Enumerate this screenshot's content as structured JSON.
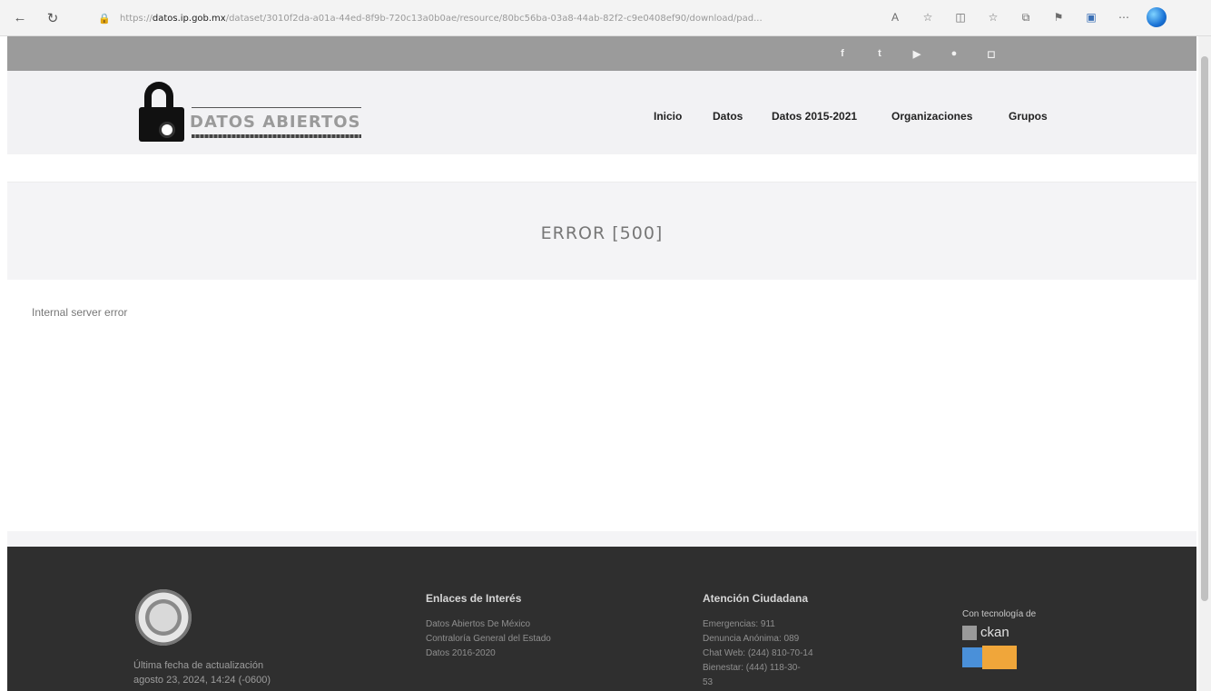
{
  "browser": {
    "url_prefix": "https://",
    "url_host": "datos.ip.gob.mx",
    "url_rest": "/dataset/3010f2da-a01a-44ed-8f9b-720c13a0b0ae/resource/80bc56ba-03a8-44ab-82f2-c9e0408ef90/download/pad...",
    "back_icon": "back-arrow-icon",
    "reload_icon": "reload-icon"
  },
  "social": {
    "items": [
      {
        "name": "facebook",
        "glyph": "f"
      },
      {
        "name": "twitter",
        "glyph": "t"
      },
      {
        "name": "youtube",
        "glyph": "▶"
      },
      {
        "name": "flickr",
        "glyph": "●"
      },
      {
        "name": "instagram",
        "glyph": "◻"
      }
    ]
  },
  "header": {
    "logo_text": "DATOS ABIERTOS",
    "nav": {
      "inicio": "Inicio",
      "datos": "Datos",
      "datos_2015": "Datos 2015-2021",
      "organizaciones": "Organizaciones",
      "grupos": "Grupos"
    }
  },
  "main": {
    "error_title": "ERROR [500]",
    "error_message": "Internal server error"
  },
  "footer": {
    "update_line1": "Última fecha de actualización",
    "update_line2": "agosto 23, 2024, 14:24 (-0600)",
    "links": {
      "heading": "Enlaces de Interés",
      "items": [
        "Datos Abiertos De México",
        "Contraloría General del Estado",
        "Datos 2016-2020"
      ]
    },
    "contact": {
      "heading": "Atención Ciudadana",
      "items": [
        "Emergencias: 911",
        "Denuncia Anónima: 089",
        "Chat Web: (244) 810-70-14",
        "Bienestar: (444) 118-30-",
        "53"
      ]
    },
    "tech": {
      "label": "Con tecnología de",
      "ckan": "ckan"
    }
  }
}
